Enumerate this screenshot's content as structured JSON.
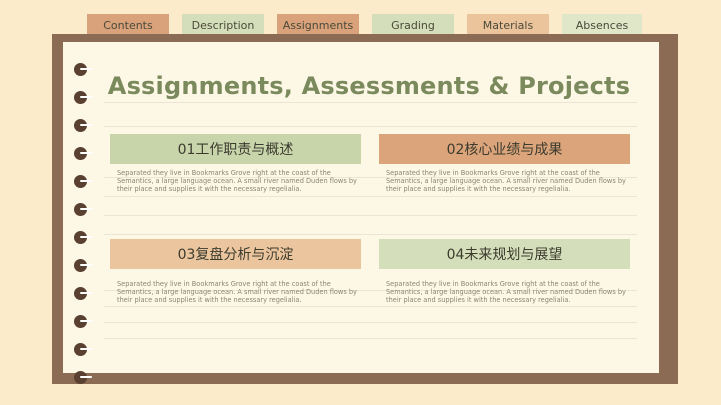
{
  "tabs": [
    {
      "label": "Contents",
      "color": "#d9a27a"
    },
    {
      "label": "Description",
      "color": "#d5deba"
    },
    {
      "label": "Assignments",
      "color": "#d9a27a"
    },
    {
      "label": "Grading",
      "color": "#d5deba"
    },
    {
      "label": "Materials",
      "color": "#ecc49c"
    },
    {
      "label": "Absences",
      "color": "#dfe7c8"
    }
  ],
  "title": "Assignments, Assessments & Projects",
  "cards": [
    {
      "heading": "01工作职责与概述",
      "color": "#c8d5ab",
      "text": "Separated they live in Bookmarks Grove right at the coast of the Semantics, a large language ocean. A small river named Duden flows by their place and supplies it with the necessary regelialia."
    },
    {
      "heading": "02核心业绩与成果",
      "color": "#dba47a",
      "text": "Separated they live in Bookmarks Grove right at the coast of the Semantics, a large language ocean. A small river named Duden flows by their place and supplies it with the necessary regelialia."
    },
    {
      "heading": "03复盘分析与沉淀",
      "color": "#ebc59d",
      "text": "Separated they live in Bookmarks Grove right at the coast of the Semantics, a large language ocean. A small river named Duden flows by their place and supplies it with the necessary regelialia."
    },
    {
      "heading": "04未来规划与展望",
      "color": "#d5deba",
      "text": "Separated they live in Bookmarks Grove right at the coast of the Semantics, a large language ocean. A small river named Duden flows by their place and supplies it with the necessary regelialia."
    }
  ],
  "colors": {
    "background": "#fbebca",
    "board": "#8b6b53",
    "paper": "#fdf7e6",
    "title": "#7b8a5c",
    "ring": "#5a4030"
  }
}
